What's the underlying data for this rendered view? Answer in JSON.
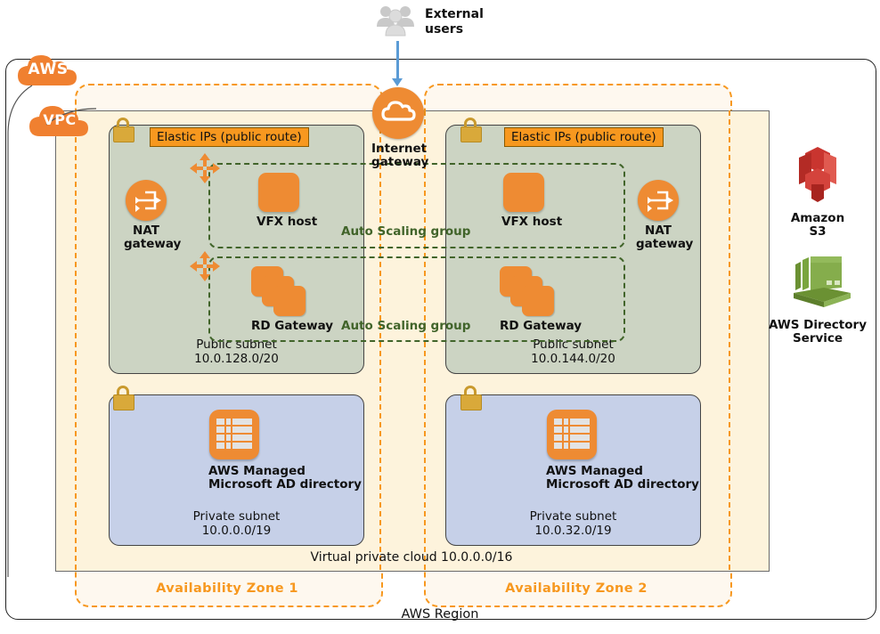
{
  "diagram": {
    "region_label": "AWS Region",
    "vpc_label": "Virtual private cloud 10.0.0.0/16",
    "aws_badge": "AWS",
    "vpc_badge": "VPC",
    "external_users": "External\nusers",
    "external_users_line1": "External",
    "external_users_line2": "users",
    "internet_gateway_line1": "Internet",
    "internet_gateway_line2": "gateway"
  },
  "availability_zones": [
    {
      "label": "Availability Zone 1",
      "elastic_ip_tag": "Elastic IPs (public route)",
      "public_subnet": {
        "name": "Public subnet",
        "cidr": "10.0.128.0/20"
      },
      "private_subnet": {
        "name": "Private subnet",
        "cidr": "10.0.0.0/19"
      },
      "nat_gateway_line1": "NAT",
      "nat_gateway_line2": "gateway",
      "vfx_host": "VFX host",
      "rd_gateway": "RD Gateway",
      "directory_line1": "AWS Managed",
      "directory_line2": "Microsoft AD directory"
    },
    {
      "label": "Availability Zone 2",
      "elastic_ip_tag": "Elastic IPs (public route)",
      "public_subnet": {
        "name": "Public subnet",
        "cidr": "10.0.144.0/20"
      },
      "private_subnet": {
        "name": "Private subnet",
        "cidr": "10.0.32.0/19"
      },
      "nat_gateway_line1": "NAT",
      "nat_gateway_line2": "gateway",
      "vfx_host": "VFX host",
      "rd_gateway": "RD Gateway",
      "directory_line1": "AWS Managed",
      "directory_line2": "Microsoft AD directory"
    }
  ],
  "auto_scaling_groups": [
    {
      "label": "Auto Scaling group"
    },
    {
      "label": "Auto Scaling group"
    },
    {
      "label": "Auto Scaling group"
    },
    {
      "label": "Auto Scaling group"
    }
  ],
  "services": [
    {
      "name_line1": "Amazon",
      "name_line2": "S3",
      "icon": "amazon-s3-icon",
      "color": "#d9453c"
    },
    {
      "name_line1": "AWS Directory",
      "name_line2": "Service",
      "icon": "aws-directory-service-icon",
      "color": "#7aa53f"
    }
  ],
  "colors": {
    "aws_orange": "#f7981f",
    "icon_orange": "#ee8b33",
    "public_subnet_bg": "#ccd4c3",
    "private_subnet_bg": "#c6d0e8",
    "vpc_bg": "#fdf3dc",
    "asg_green": "#41642a",
    "lock_gold": "#d9a93a",
    "arrow_blue": "#5b9bd5",
    "s3_red": "#d9453c",
    "ds_green": "#7aa53f"
  }
}
